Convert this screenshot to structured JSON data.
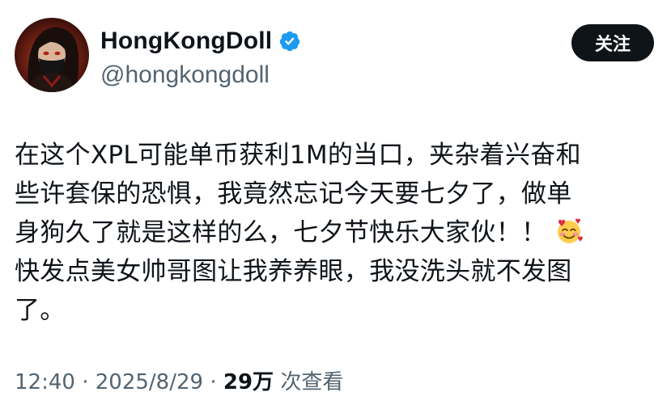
{
  "author": {
    "display_name": "HongKongDoll",
    "handle": "@hongkongdoll",
    "verified": true,
    "avatar_icon": "profile-avatar"
  },
  "follow_button": {
    "label": "关注"
  },
  "tweet": {
    "line1": "在这个XPL可能单币获利1M的当口，夹杂着兴奋和",
    "line2": "些许套保的恐惧，我竟然忘记今天要七夕了，做单",
    "line3_text": "身狗久了就是这样的么，七夕节快乐大家伙！！",
    "line3_emoji": "smiling-face-with-hearts-icon",
    "line4": "快发点美女帅哥图让我养养眼，我没洗头就不发图",
    "line5": "了。"
  },
  "meta": {
    "time": "12:40",
    "date": "2025/8/29",
    "separator": "·",
    "views_count": "29万",
    "views_label": "次查看"
  },
  "colors": {
    "text_primary": "#0f1419",
    "text_secondary": "#536471",
    "verified_blue": "#1d9bf0",
    "button_bg": "#0f1419"
  }
}
